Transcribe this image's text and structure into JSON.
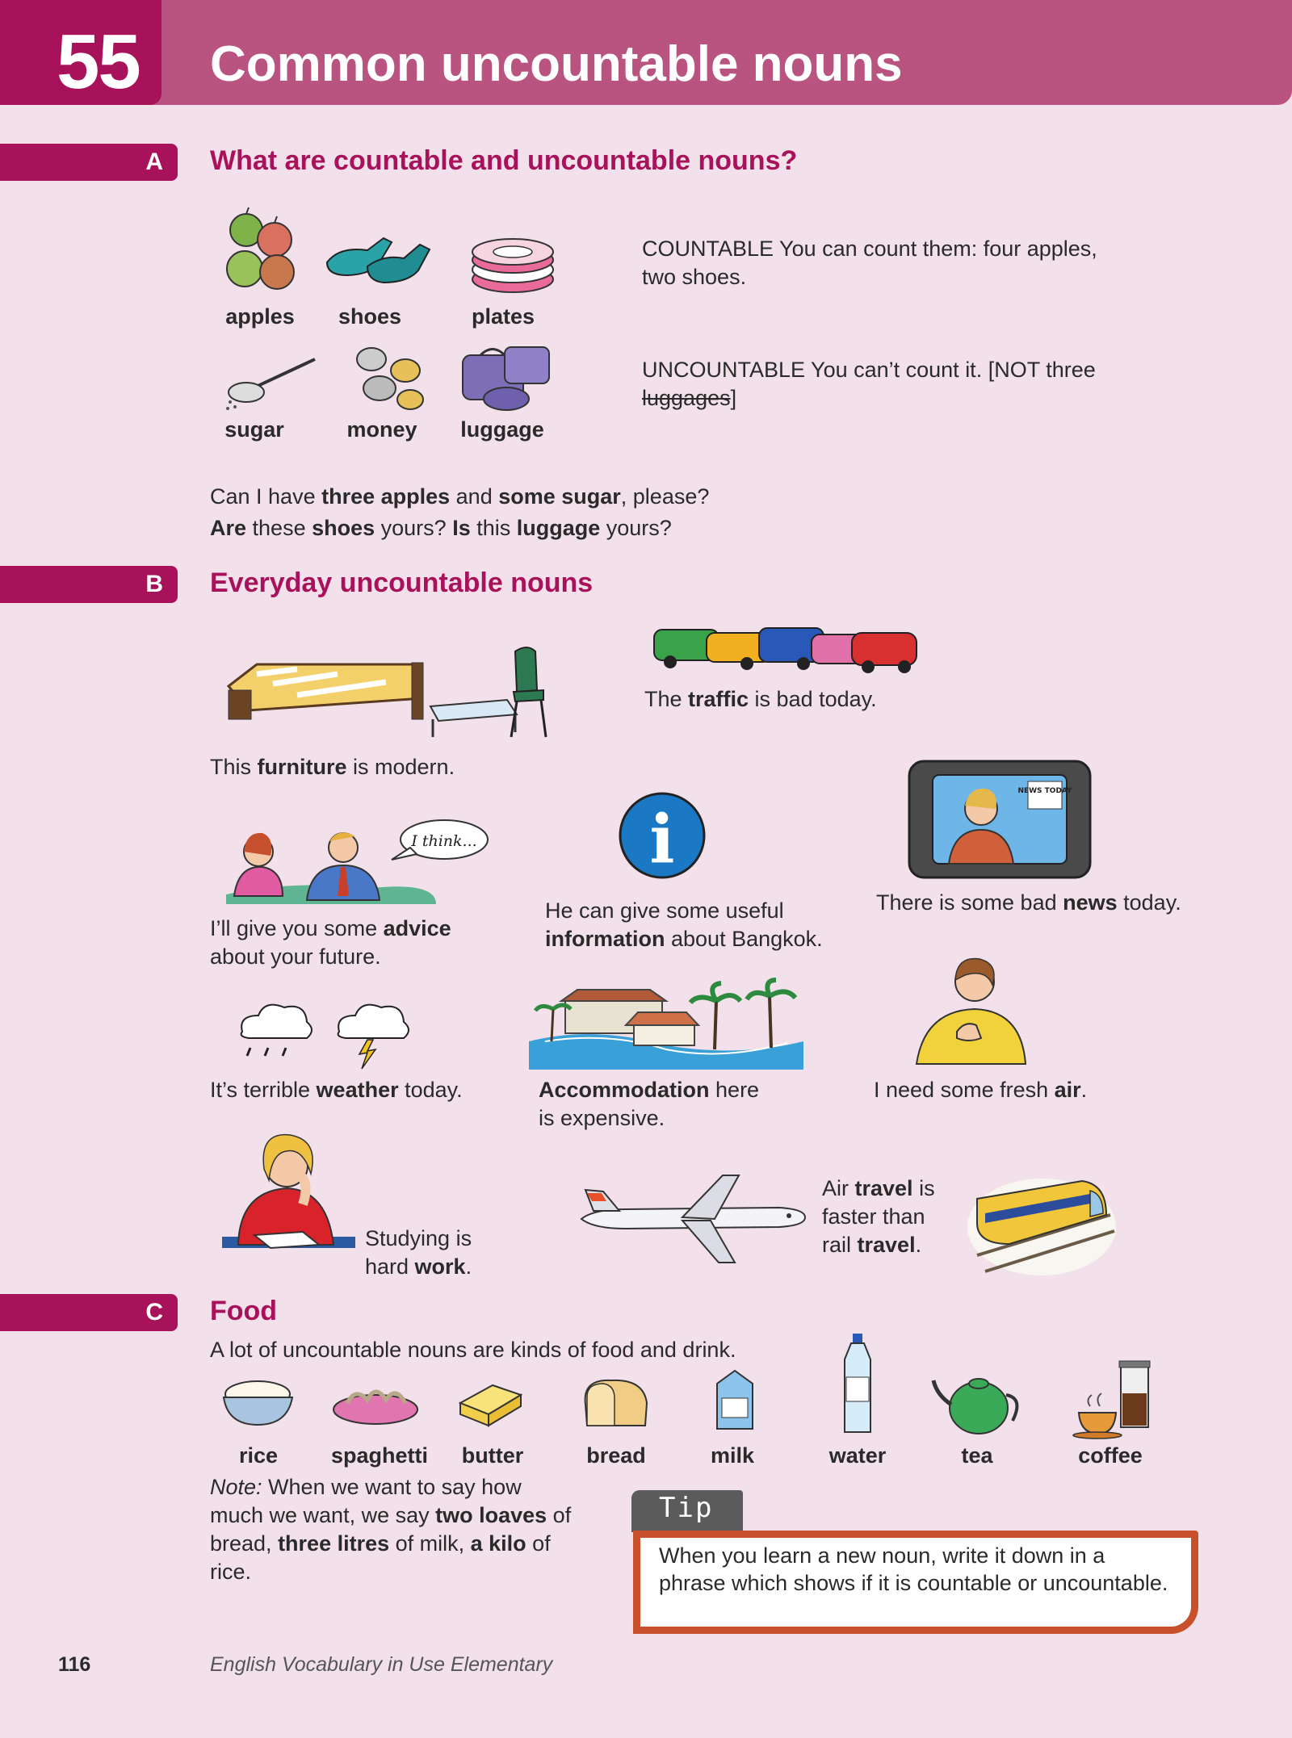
{
  "header": {
    "unit_number": "55",
    "title": "Common uncountable nouns"
  },
  "sections": {
    "a": {
      "letter": "A",
      "title": "What are countable and uncountable nouns?",
      "countable_labels": [
        "apples",
        "shoes",
        "plates"
      ],
      "uncountable_labels": [
        "sugar",
        "money",
        "luggage"
      ],
      "countable_note": "COUNTABLE You can count them: four apples, two shoes.",
      "uncountable_note_pre": "UNCOUNTABLE You can’t count it. [NOT three ",
      "uncountable_note_struck": "luggages",
      "uncountable_note_post": "]",
      "example_1": {
        "p1": "Can I have ",
        "b1": "three apples",
        "p2": " and ",
        "b2": "some sugar",
        "p3": ", please?"
      },
      "example_2": {
        "b1": "Are",
        "p1": " these ",
        "b2": "shoes",
        "p2": " yours? ",
        "b3": "Is",
        "p3": " this ",
        "b4": "luggage",
        "p4": " yours?"
      }
    },
    "b": {
      "letter": "B",
      "title": "Everyday uncountable nouns",
      "traffic": {
        "p1": "The ",
        "b": "traffic",
        "p2": " is bad today."
      },
      "furniture": {
        "p1": "This ",
        "b": "furniture",
        "p2": " is modern."
      },
      "advice": {
        "p1": "I’ll give you some ",
        "b": "advice",
        "p2": "about your future."
      },
      "speech_bubble": "I think...",
      "information": {
        "p1": "He can give some useful",
        "b": "information",
        "p2": " about Bangkok."
      },
      "info_icon": "i",
      "news": {
        "p1": "There is some bad ",
        "b": "news",
        "p2": " today."
      },
      "tv_sign": "NEWS TODAY",
      "weather": {
        "p1": "It’s terrible ",
        "b": "weather",
        "p2": " today."
      },
      "accommodation": {
        "b": "Accommodation",
        "p1": " here",
        "p2": "is expensive."
      },
      "air": {
        "p1": "I need some fresh ",
        "b": "air",
        "p2": "."
      },
      "work": {
        "p1": "Studying is",
        "p2": "hard ",
        "b": "work",
        "p3": "."
      },
      "travel": {
        "p1": "Air ",
        "b1": "travel",
        "p2": " is",
        "p3": "faster than",
        "p4": "rail ",
        "b2": "travel",
        "p5": "."
      }
    },
    "c": {
      "letter": "C",
      "title": "Food",
      "intro": "A lot of uncountable nouns are kinds of food and drink.",
      "food_labels": [
        "rice",
        "spaghetti",
        "butter",
        "bread",
        "milk",
        "water",
        "tea",
        "coffee"
      ],
      "note": {
        "i": "Note:",
        "p1": " When we want to say how",
        "p2": "much we want, we say ",
        "b1": "two loaves",
        "p3": " of",
        "p4": "bread, ",
        "b2": "three litres",
        "p5": " of milk, ",
        "b3": "a kilo",
        "p6": " of",
        "p7": "rice."
      }
    }
  },
  "tip": {
    "label": "Tip",
    "text": "When you learn a new noun, write it down in a phrase which shows if it is countable or uncountable."
  },
  "footer": {
    "page_number": "116",
    "book_title": "English Vocabulary in Use Elementary"
  },
  "colors": {
    "header": "#b9537f",
    "accent": "#a8125a",
    "background": "#f2e1ea",
    "tip_border": "#c8502a"
  }
}
